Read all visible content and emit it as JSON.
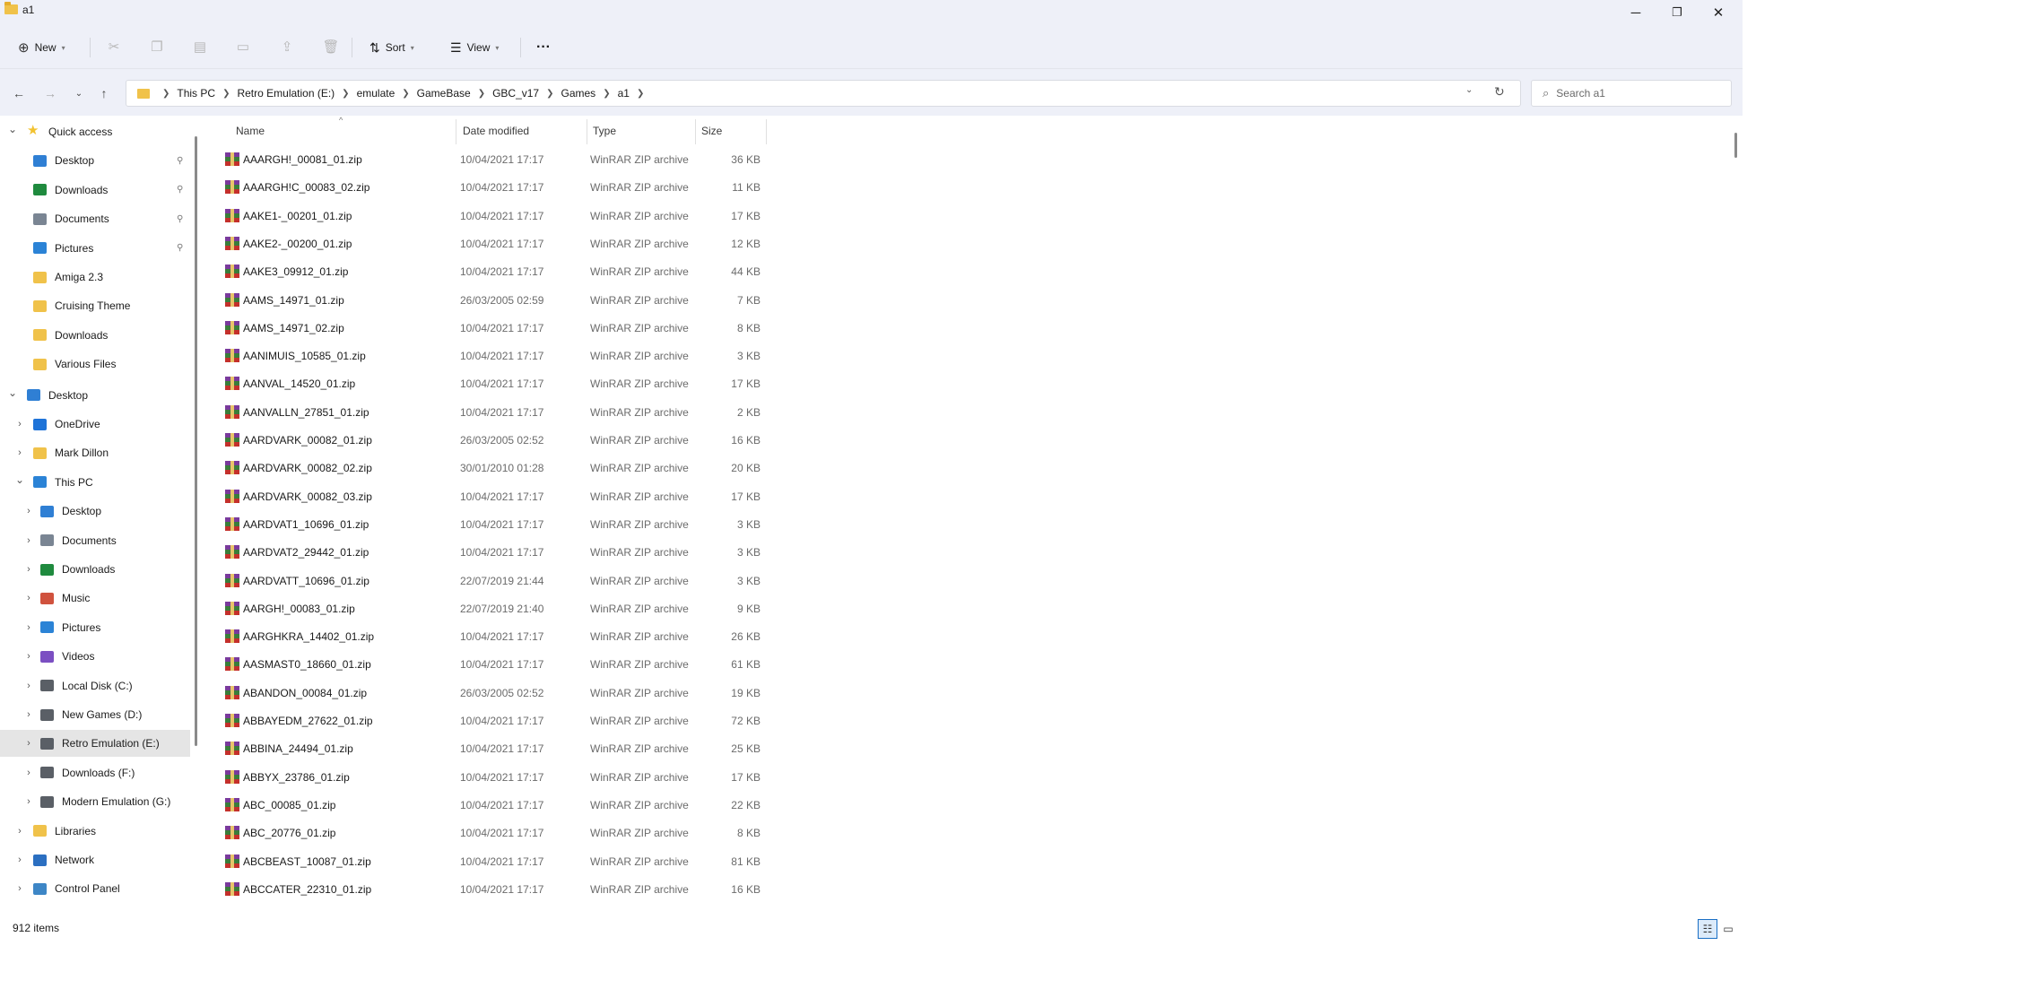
{
  "window": {
    "title": "a1",
    "minimize_glyph": "─",
    "maximize_glyph": "❐",
    "close_glyph": "✕"
  },
  "toolbar": {
    "new_label": "New",
    "sort_label": "Sort",
    "view_label": "View",
    "more_glyph": "···",
    "icons": [
      "cut-icon",
      "copy-icon",
      "paste-icon",
      "rename-icon",
      "share-icon",
      "delete-icon"
    ]
  },
  "address": {
    "crumbs": [
      "This PC",
      "Retro Emulation (E:)",
      "emulate",
      "GameBase",
      "GBC_v17",
      "Games",
      "a1"
    ],
    "search_placeholder": "Search a1"
  },
  "nav": {
    "quick_access": "Quick access",
    "quick_items": [
      {
        "label": "Desktop",
        "pinned": true,
        "icon": "desktop-icon",
        "color": "#2f7fd4"
      },
      {
        "label": "Downloads",
        "pinned": true,
        "icon": "downloads-icon",
        "color": "#1f8a3e"
      },
      {
        "label": "Documents",
        "pinned": true,
        "icon": "documents-icon",
        "color": "#7a8593"
      },
      {
        "label": "Pictures",
        "pinned": true,
        "icon": "pictures-icon",
        "color": "#2b83d6"
      },
      {
        "label": "Amiga 2.3",
        "pinned": false,
        "icon": "folder-icon",
        "color": "#f0c24a"
      },
      {
        "label": "Cruising Theme",
        "pinned": false,
        "icon": "folder-icon",
        "color": "#f0c24a"
      },
      {
        "label": "Downloads",
        "pinned": false,
        "icon": "folder-icon",
        "color": "#f0c24a"
      },
      {
        "label": "Various Files",
        "pinned": false,
        "icon": "folder-icon",
        "color": "#f0c24a"
      }
    ],
    "desktop": "Desktop",
    "desktop_items": [
      {
        "label": "OneDrive",
        "icon": "onedrive-icon",
        "color": "#1e73d8"
      },
      {
        "label": "Mark Dillon",
        "icon": "folder-icon",
        "color": "#f0c24a"
      }
    ],
    "this_pc": "This PC",
    "pc_items": [
      {
        "label": "Desktop",
        "icon": "desktop-icon",
        "color": "#2f7fd4"
      },
      {
        "label": "Documents",
        "icon": "documents-icon",
        "color": "#7a8593"
      },
      {
        "label": "Downloads",
        "icon": "downloads-icon",
        "color": "#1f8a3e"
      },
      {
        "label": "Music",
        "icon": "music-icon",
        "color": "#d0523e"
      },
      {
        "label": "Pictures",
        "icon": "pictures-icon",
        "color": "#2b83d6"
      },
      {
        "label": "Videos",
        "icon": "videos-icon",
        "color": "#7b4fc2"
      },
      {
        "label": "Local Disk (C:)",
        "icon": "drive-icon",
        "color": "#5a5f66"
      },
      {
        "label": "New Games (D:)",
        "icon": "drive-icon",
        "color": "#5a5f66"
      },
      {
        "label": "Retro Emulation (E:)",
        "icon": "drive-icon",
        "color": "#5a5f66",
        "selected": true
      },
      {
        "label": "Downloads (F:)",
        "icon": "drive-icon",
        "color": "#5a5f66"
      },
      {
        "label": "Modern Emulation (G:)",
        "icon": "drive-icon",
        "color": "#5a5f66"
      }
    ],
    "bottom_items": [
      {
        "label": "Libraries",
        "icon": "libraries-icon",
        "color": "#f0c24a"
      },
      {
        "label": "Network",
        "icon": "network-icon",
        "color": "#2b6fc1"
      },
      {
        "label": "Control Panel",
        "icon": "control-panel-icon",
        "color": "#3d86c6"
      }
    ]
  },
  "columns": {
    "name": "Name",
    "date": "Date modified",
    "type": "Type",
    "size": "Size"
  },
  "files": [
    {
      "name": "AAARGH!_00081_01.zip",
      "date": "10/04/2021 17:17",
      "type": "WinRAR ZIP archive",
      "size": "36 KB"
    },
    {
      "name": "AAARGH!C_00083_02.zip",
      "date": "10/04/2021 17:17",
      "type": "WinRAR ZIP archive",
      "size": "11 KB"
    },
    {
      "name": "AAKE1-_00201_01.zip",
      "date": "10/04/2021 17:17",
      "type": "WinRAR ZIP archive",
      "size": "17 KB"
    },
    {
      "name": "AAKE2-_00200_01.zip",
      "date": "10/04/2021 17:17",
      "type": "WinRAR ZIP archive",
      "size": "12 KB"
    },
    {
      "name": "AAKE3_09912_01.zip",
      "date": "10/04/2021 17:17",
      "type": "WinRAR ZIP archive",
      "size": "44 KB"
    },
    {
      "name": "AAMS_14971_01.zip",
      "date": "26/03/2005 02:59",
      "type": "WinRAR ZIP archive",
      "size": "7 KB"
    },
    {
      "name": "AAMS_14971_02.zip",
      "date": "10/04/2021 17:17",
      "type": "WinRAR ZIP archive",
      "size": "8 KB"
    },
    {
      "name": "AANIMUIS_10585_01.zip",
      "date": "10/04/2021 17:17",
      "type": "WinRAR ZIP archive",
      "size": "3 KB"
    },
    {
      "name": "AANVAL_14520_01.zip",
      "date": "10/04/2021 17:17",
      "type": "WinRAR ZIP archive",
      "size": "17 KB"
    },
    {
      "name": "AANVALLN_27851_01.zip",
      "date": "10/04/2021 17:17",
      "type": "WinRAR ZIP archive",
      "size": "2 KB"
    },
    {
      "name": "AARDVARK_00082_01.zip",
      "date": "26/03/2005 02:52",
      "type": "WinRAR ZIP archive",
      "size": "16 KB"
    },
    {
      "name": "AARDVARK_00082_02.zip",
      "date": "30/01/2010 01:28",
      "type": "WinRAR ZIP archive",
      "size": "20 KB"
    },
    {
      "name": "AARDVARK_00082_03.zip",
      "date": "10/04/2021 17:17",
      "type": "WinRAR ZIP archive",
      "size": "17 KB"
    },
    {
      "name": "AARDVAT1_10696_01.zip",
      "date": "10/04/2021 17:17",
      "type": "WinRAR ZIP archive",
      "size": "3 KB"
    },
    {
      "name": "AARDVAT2_29442_01.zip",
      "date": "10/04/2021 17:17",
      "type": "WinRAR ZIP archive",
      "size": "3 KB"
    },
    {
      "name": "AARDVATT_10696_01.zip",
      "date": "22/07/2019 21:44",
      "type": "WinRAR ZIP archive",
      "size": "3 KB"
    },
    {
      "name": "AARGH!_00083_01.zip",
      "date": "22/07/2019 21:40",
      "type": "WinRAR ZIP archive",
      "size": "9 KB"
    },
    {
      "name": "AARGHKRA_14402_01.zip",
      "date": "10/04/2021 17:17",
      "type": "WinRAR ZIP archive",
      "size": "26 KB"
    },
    {
      "name": "AASMAST0_18660_01.zip",
      "date": "10/04/2021 17:17",
      "type": "WinRAR ZIP archive",
      "size": "61 KB"
    },
    {
      "name": "ABANDON_00084_01.zip",
      "date": "26/03/2005 02:52",
      "type": "WinRAR ZIP archive",
      "size": "19 KB"
    },
    {
      "name": "ABBAYEDM_27622_01.zip",
      "date": "10/04/2021 17:17",
      "type": "WinRAR ZIP archive",
      "size": "72 KB"
    },
    {
      "name": "ABBINA_24494_01.zip",
      "date": "10/04/2021 17:17",
      "type": "WinRAR ZIP archive",
      "size": "25 KB"
    },
    {
      "name": "ABBYX_23786_01.zip",
      "date": "10/04/2021 17:17",
      "type": "WinRAR ZIP archive",
      "size": "17 KB"
    },
    {
      "name": "ABC_00085_01.zip",
      "date": "10/04/2021 17:17",
      "type": "WinRAR ZIP archive",
      "size": "22 KB"
    },
    {
      "name": "ABC_20776_01.zip",
      "date": "10/04/2021 17:17",
      "type": "WinRAR ZIP archive",
      "size": "8 KB"
    },
    {
      "name": "ABCBEAST_10087_01.zip",
      "date": "10/04/2021 17:17",
      "type": "WinRAR ZIP archive",
      "size": "81 KB"
    },
    {
      "name": "ABCCATER_22310_01.zip",
      "date": "10/04/2021 17:17",
      "type": "WinRAR ZIP archive",
      "size": "16 KB"
    }
  ],
  "status": {
    "item_count": "912 items"
  }
}
